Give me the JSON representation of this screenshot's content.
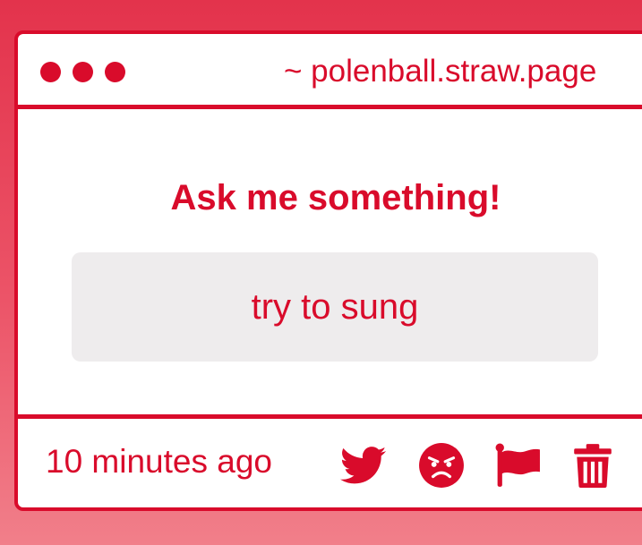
{
  "window": {
    "url": "~ polenball.straw.page"
  },
  "main": {
    "heading": "Ask me something!",
    "answer": "try to sung"
  },
  "footer": {
    "timestamp": "10 minutes ago",
    "actions": [
      {
        "icon": "twitter-icon"
      },
      {
        "icon": "angry-face-icon"
      },
      {
        "icon": "flag-icon"
      },
      {
        "icon": "trash-icon"
      }
    ]
  },
  "colors": {
    "accent": "#d90b2b",
    "background_top": "#e3334c",
    "background_bottom": "#f17f8a",
    "answer_box": "#eeeced",
    "window_bg": "#ffffff"
  }
}
